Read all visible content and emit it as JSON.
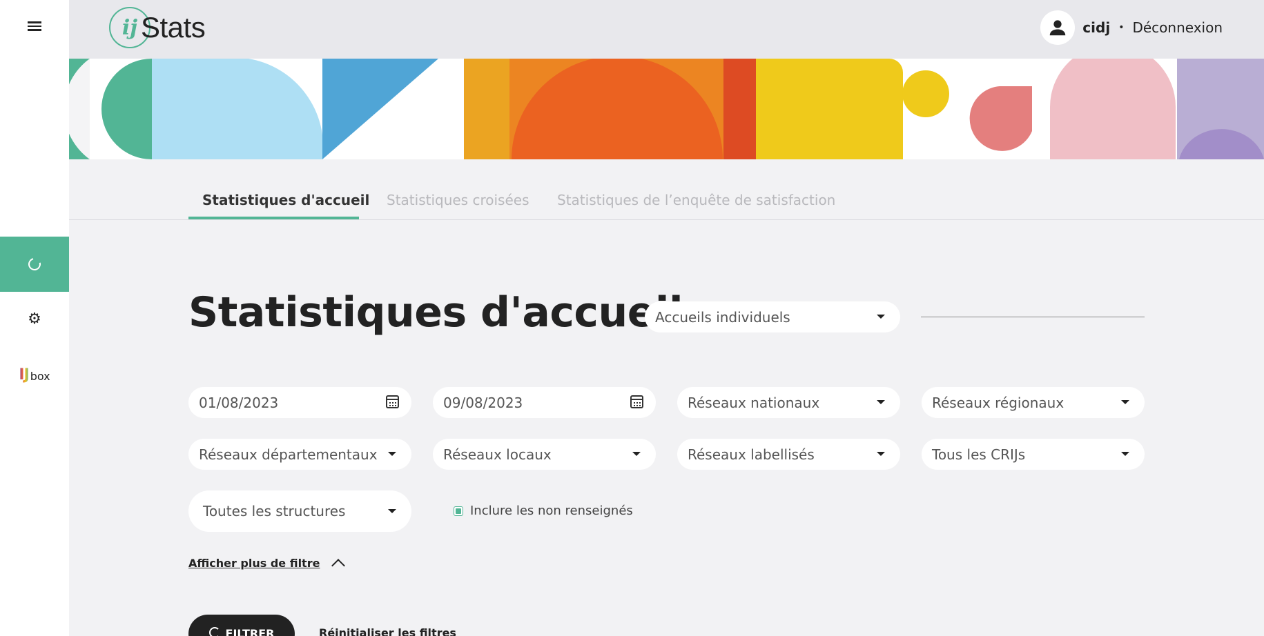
{
  "sidebar": {
    "items": [
      {
        "name": "menu",
        "icon": "menu-icon"
      },
      {
        "name": "statistics",
        "icon": "loading-ring-icon",
        "active": true
      },
      {
        "name": "settings",
        "icon": "gear-icon"
      },
      {
        "name": "ijbox",
        "icon": "ijbox-logo",
        "label_ij": "IJ",
        "label_box": "box"
      }
    ]
  },
  "header": {
    "logo_mark": "ij",
    "logo_text": "Stats",
    "username": "cidj",
    "separator": "•",
    "logout_label": "Déconnexion"
  },
  "tabs": [
    {
      "label": "Statistiques d'accueil",
      "active": true
    },
    {
      "label": "Statistiques croisées",
      "active": false
    },
    {
      "label": "Statistiques de l’enquête de satisfaction",
      "active": false
    }
  ],
  "main": {
    "title": "Statistiques d'accueil",
    "type_select": "Accueils individuels",
    "filters": {
      "date_start": "01/08/2023",
      "date_end": "09/08/2023",
      "reseaux_nationaux": "Réseaux nationaux",
      "reseaux_regionaux": "Réseaux régionaux",
      "reseaux_departementaux": "Réseaux départementaux",
      "reseaux_locaux": "Réseaux locaux",
      "reseaux_labellises": "Réseaux labellisés",
      "crijs": "Tous les CRIJs",
      "structures": "Toutes les structures",
      "include_unspecified_label": "Inclure les non renseignés",
      "include_unspecified_checked": true
    },
    "more_filters_label": "Afficher plus de filtre",
    "filter_button_label": "FILTRER",
    "reset_label": "Réinitialiser les filtres"
  },
  "colors": {
    "accent": "#52b595",
    "dark": "#222222",
    "header_bg": "#e8e8ec",
    "page_bg": "#f2f2f4"
  }
}
